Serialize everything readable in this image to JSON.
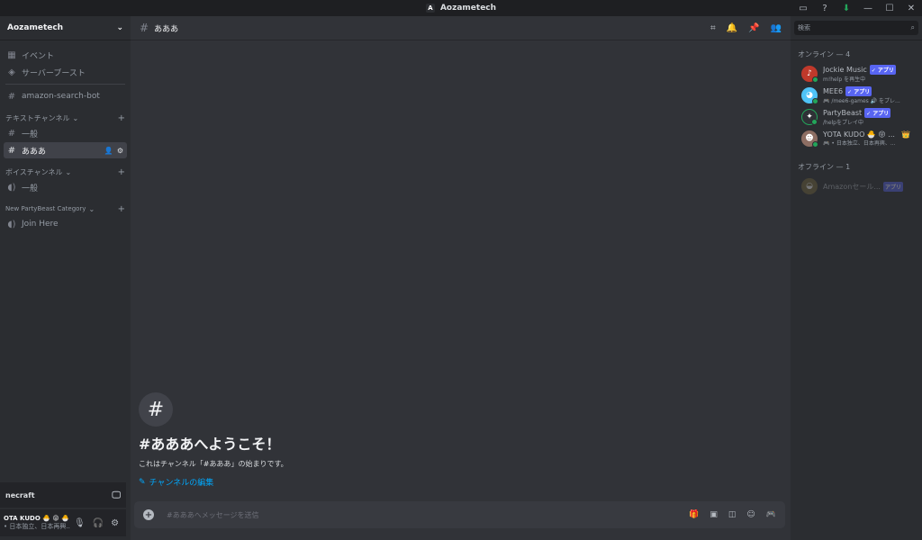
{
  "titlebar": {
    "app_title": "Aozametech",
    "logo_letter": "A",
    "icons": [
      "inbox-icon",
      "help-icon",
      "download-icon"
    ],
    "window_controls": [
      "minimize-icon",
      "maximize-icon",
      "close-icon"
    ]
  },
  "server": {
    "name": "Aozametech",
    "top_items": [
      {
        "label": "イベント",
        "icon": "calendar-icon"
      },
      {
        "label": "サーバーブースト",
        "icon": "boost-icon"
      }
    ],
    "pinned_channel": "amazon-search-bot",
    "categories": [
      {
        "name": "テキストチャンネル",
        "channels": [
          {
            "label": "一般"
          },
          {
            "label": "あああ"
          }
        ]
      },
      {
        "name": "ボイスチャンネル",
        "channels": [
          {
            "label": "一般"
          }
        ]
      },
      {
        "name": "New PartyBeast Category",
        "channels": [
          {
            "label": "Join Here"
          }
        ]
      }
    ]
  },
  "voice_panel": {
    "label": "necraft"
  },
  "user_panel": {
    "name": "OTA KUDO 🐣 😝 🐣",
    "status": "• 日本独立、日本再興..."
  },
  "channel": {
    "name": "あああ",
    "welcome_title": "#あああへようこそ！",
    "welcome_subtitle": "これはチャンネル「#あああ」の始まりです。",
    "edit_link": "チャンネルの編集",
    "composer_placeholder": "#あああへメッセージを送信"
  },
  "members": {
    "search_placeholder": "検索",
    "online_header": "オンライン — 4",
    "offline_header": "オフライン — 1",
    "app_badge": "✓ アプリ",
    "offline_badge": "アプリ",
    "online": [
      {
        "name": "Jockie Music",
        "status": "m!help を再生中",
        "avatar_color": "#c0392b",
        "badge": true
      },
      {
        "name": "MEE6",
        "status": "🎮 /mee6-games 🔊 をプレ...",
        "avatar_color": "#4fc3f7",
        "badge": true
      },
      {
        "name": "PartyBeast",
        "status": "/helpをプレイ中",
        "avatar_color": "#2f3136",
        "badge": true
      },
      {
        "name": "YOTA KUDO 🐣 😝 ...",
        "status": "🎮 • 日本独立、日本再興、...",
        "avatar_color": "#8d6e63",
        "badge": false,
        "crown": "👑"
      }
    ],
    "offline": [
      {
        "name": "Amazonセール...",
        "avatar_color": "#7a6a3a"
      }
    ]
  },
  "colors": {
    "accent": "#5865f2",
    "link": "#00a8fc",
    "online": "#23a55a"
  }
}
